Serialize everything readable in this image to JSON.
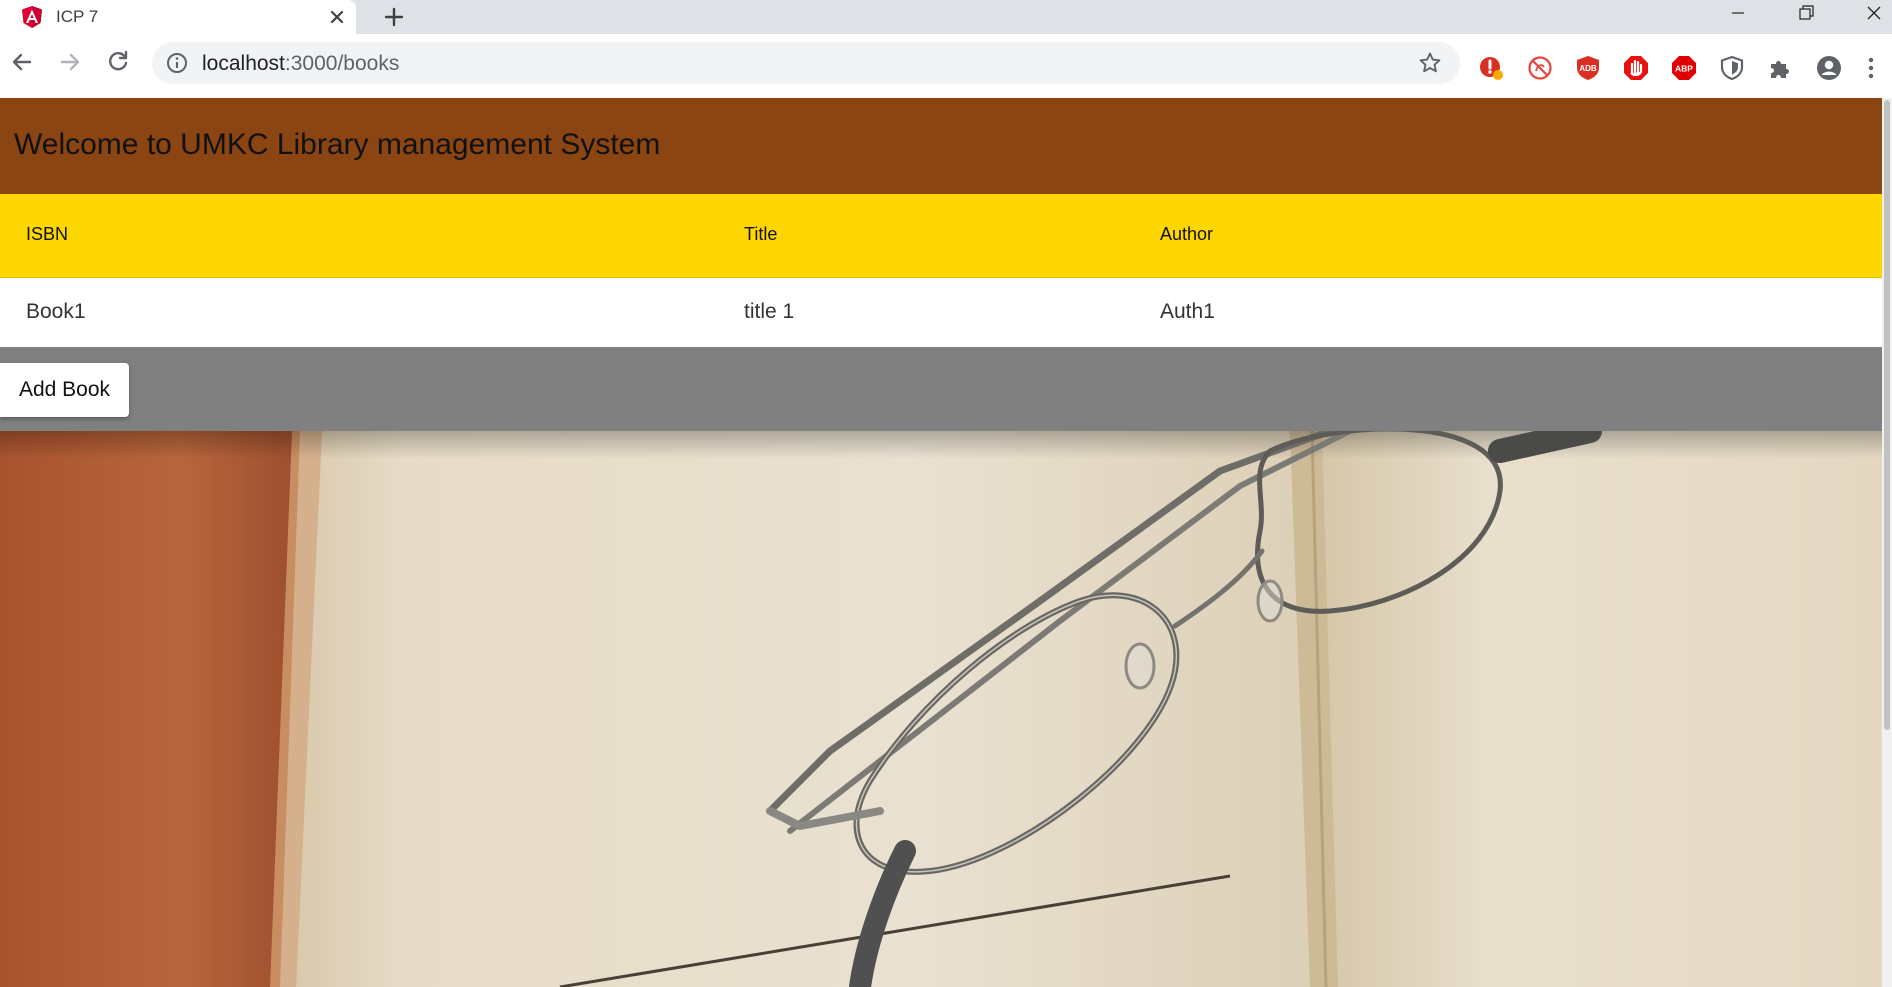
{
  "browser": {
    "tab_title": "ICP 7",
    "url_host": "localhost",
    "url_path": ":3000/books",
    "extensions": [
      "alert-extension-icon",
      "no-entry-extension-icon",
      "adblock-extension-icon",
      "stop-hand-extension-icon",
      "abp-extension-icon",
      "shield-extension-icon",
      "puzzle-icon"
    ],
    "abp_label": "ABP",
    "adb_label": "ADB"
  },
  "page": {
    "header_title": "Welcome to UMKC Library management System",
    "table": {
      "headers": [
        "ISBN",
        "Title",
        "Author"
      ],
      "rows": [
        [
          "Book1",
          "title 1",
          "Auth1"
        ]
      ]
    },
    "add_button_label": "Add Book"
  },
  "colors": {
    "header_bg": "#8b4513",
    "table_header_bg": "#ffd700",
    "action_bar_bg": "#808080"
  }
}
